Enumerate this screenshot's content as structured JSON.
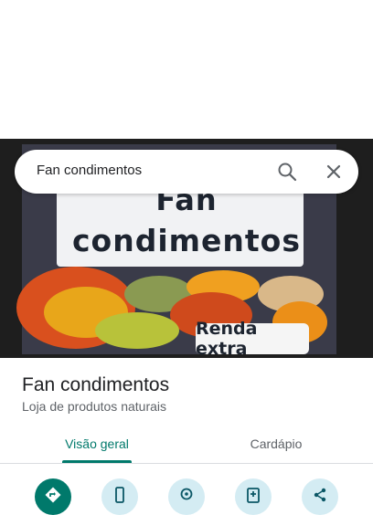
{
  "search": {
    "query": "Fan condimentos"
  },
  "photo": {
    "headline_line1": "Fan",
    "headline_line2": "condimentos",
    "badge": "Renda extra"
  },
  "place": {
    "name": "Fan condimentos",
    "category": "Loja de produtos naturais"
  },
  "tabs": [
    {
      "label": "Visão geral",
      "selected": true
    },
    {
      "label": "Cardápio",
      "selected": false
    }
  ],
  "actions": [
    {
      "icon": "directions-icon",
      "primary": true
    },
    {
      "icon": "phone-icon",
      "primary": false
    },
    {
      "icon": "location-icon",
      "primary": false
    },
    {
      "icon": "save-icon",
      "primary": false
    },
    {
      "icon": "share-icon",
      "primary": false
    }
  ],
  "colors": {
    "accent": "#00796b",
    "action_bg": "#d4ecf3"
  }
}
